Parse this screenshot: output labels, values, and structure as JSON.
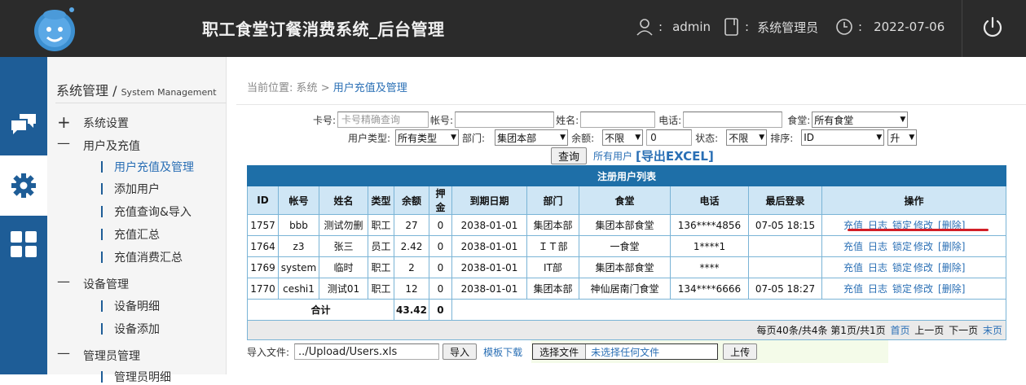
{
  "header": {
    "title": "职工食堂订餐消费系统_后台管理",
    "user_sep": ":",
    "user": "admin",
    "role": "系统管理员",
    "date": "2022-07-06"
  },
  "sidebar": {
    "title": "系统管理 /",
    "title_en": "System Management",
    "groups": [
      {
        "label": "系统设置",
        "marker": "+"
      },
      {
        "label": "用户及充值",
        "marker": "—"
      },
      {
        "label": "设备管理",
        "marker": "—"
      },
      {
        "label": "管理员管理",
        "marker": "—"
      }
    ],
    "items_user": [
      "用户充值及管理",
      "添加用户",
      "充值查询&导入",
      "充值汇总",
      "充值消费汇总"
    ],
    "items_device": [
      "设备明细",
      "设备添加"
    ],
    "items_admin": [
      "管理员明细"
    ]
  },
  "breadcrumb": {
    "prefix": "当前位置:",
    "root": "系统",
    "sep": ">",
    "current": "用户充值及管理"
  },
  "filters": {
    "card_label": "卡号:",
    "card_placeholder": "卡号精确查询",
    "account_label": "帐号:",
    "name_label": "姓名:",
    "phone_label": "电话:",
    "canteen_label": "食堂:",
    "canteen_value": "所有食堂",
    "usertype_label": "用户类型:",
    "usertype_value": "所有类型",
    "dept_label": "部门:",
    "dept_value": "集团本部",
    "balance_label": "余额:",
    "balance_op": "不限",
    "balance_value": "0",
    "status_label": "状态:",
    "status_value": "不限",
    "sort_label": "排序:",
    "sort_value": "ID",
    "order_value": "升",
    "query_button": "查询",
    "all_users": "所有用户",
    "export": "[导出EXCEL]"
  },
  "table": {
    "caption": "注册用户列表",
    "headers": [
      "ID",
      "帐号",
      "姓名",
      "类型",
      "余额",
      "押金",
      "到期日期",
      "部门",
      "食堂",
      "电话",
      "最后登录",
      "操作"
    ],
    "rows": [
      [
        "1757",
        "bbb",
        "测试勿删",
        "职工",
        "27",
        "0",
        "2038-01-01",
        "集团本部",
        "集团本部食堂",
        "136****4856",
        "07-05 18:15"
      ],
      [
        "1764",
        "z3",
        "张三",
        "员工",
        "2.42",
        "0",
        "2038-01-01",
        "ＩＴ部",
        "一食堂",
        "1****1",
        ""
      ],
      [
        "1769",
        "system",
        "临时",
        "职工",
        "2",
        "0",
        "2038-01-01",
        "IT部",
        "集团本部食堂",
        "****",
        ""
      ],
      [
        "1770",
        "ceshi1",
        "测试01",
        "职工",
        "12",
        "0",
        "2038-01-01",
        "集团本部",
        "神仙居南门食堂",
        "134****6666",
        "07-05 18:27"
      ]
    ],
    "ops": {
      "recharge": "充值",
      "log": "日志",
      "lock": "锁定",
      "edit": "修改",
      "delete": "[删除]"
    },
    "total_label": "合计",
    "total_balance": "43.42",
    "total_deposit": "0",
    "pager_info": "每页40条/共4条 第1页/共1页",
    "first": "首页",
    "prev": "上一页",
    "next": "下一页",
    "last": "末页"
  },
  "import": {
    "label": "导入文件:",
    "path": "../Upload/Users.xls",
    "import_button": "导入",
    "template": "模板下载",
    "choose_file": "选择文件",
    "no_file": "未选择任何文件",
    "upload_button": "上传"
  },
  "colors": {
    "header_bg": "#2b2b2b",
    "sidebar_bg": "#1e5d97",
    "table_caption": "#1e6fa8",
    "link": "#2a6fb5",
    "highlight": "#d21f27"
  }
}
